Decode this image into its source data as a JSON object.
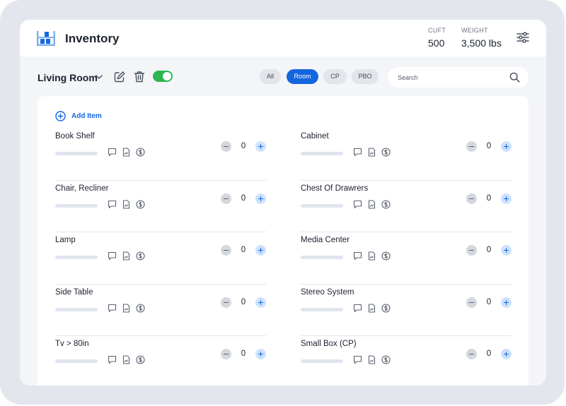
{
  "header": {
    "title": "Inventory",
    "stats": [
      {
        "label": "CUFT",
        "value": "500"
      },
      {
        "label": "WEIGHT",
        "value": "3,500 lbs"
      }
    ]
  },
  "toolbar": {
    "room_name": "Living Room",
    "toggle_on": true,
    "filters": [
      {
        "label": "All",
        "active": false
      },
      {
        "label": "Room",
        "active": true
      },
      {
        "label": "CP",
        "active": false
      },
      {
        "label": "PBO",
        "active": false
      }
    ],
    "search_placeholder": "Search"
  },
  "panel": {
    "add_item_label": "Add Item",
    "items": [
      {
        "name": "Book Shelf",
        "qty": "0"
      },
      {
        "name": "Cabinet",
        "qty": "0"
      },
      {
        "name": "Chair, Recliner",
        "qty": "0"
      },
      {
        "name": "Chest Of Drawrers",
        "qty": "0"
      },
      {
        "name": "Lamp",
        "qty": "0"
      },
      {
        "name": "Media Center",
        "qty": "0"
      },
      {
        "name": "Side Table",
        "qty": "0"
      },
      {
        "name": "Stereo System",
        "qty": "0"
      },
      {
        "name": "Tv > 80in",
        "qty": "0"
      },
      {
        "name": "Small Box (CP)",
        "qty": "0"
      }
    ]
  },
  "colors": {
    "accent": "#1466e0",
    "toggle_on": "#2db551",
    "screen_bg": "#f4f5f8",
    "bezel": "#e3e6ec"
  },
  "icons": [
    "inventory-icon",
    "settings-sliders-icon",
    "chevron-down-icon",
    "edit-icon",
    "trash-icon",
    "search-icon",
    "plus-circle-icon",
    "comment-icon",
    "document-icon",
    "dollar-icon",
    "minus-icon",
    "plus-icon"
  ]
}
